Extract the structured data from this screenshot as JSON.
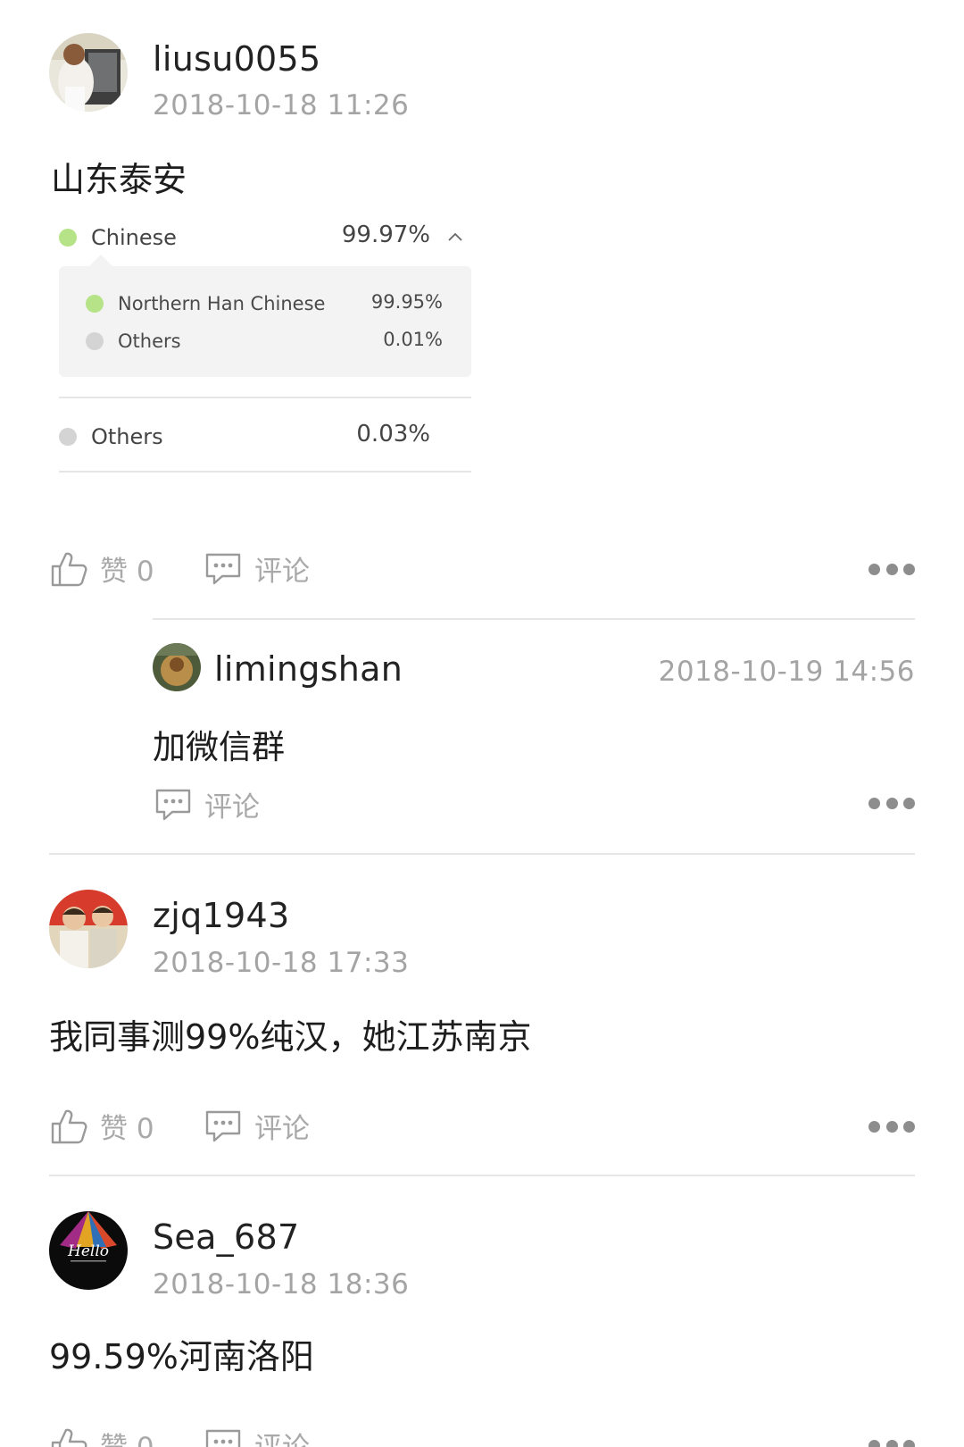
{
  "posts": [
    {
      "username": "liusu0055",
      "date": "2018-10-18 11:26",
      "content": "山东泰安",
      "ancestry": {
        "top": {
          "label": "Chinese",
          "percent": "99.97%",
          "color": "#b6e388"
        },
        "sub": [
          {
            "label": "Northern Han Chinese",
            "percent": "99.95%",
            "color": "#b6e388"
          },
          {
            "label": "Others",
            "percent": "0.01%",
            "color": "#d4d4d4"
          }
        ],
        "other": {
          "label": "Others",
          "percent": "0.03%",
          "color": "#d4d4d4"
        }
      },
      "like_label": "赞 0",
      "comment_label": "评论",
      "reply": {
        "username": "limingshan",
        "date": "2018-10-19 14:56",
        "content": "加微信群",
        "comment_label": "评论"
      }
    },
    {
      "username": "zjq1943",
      "date": "2018-10-18 17:33",
      "content": "我同事测99%纯汉，她江苏南京",
      "like_label": "赞 0",
      "comment_label": "评论"
    },
    {
      "username": "Sea_687",
      "date": "2018-10-18 18:36",
      "content": "99.59%河南洛阳",
      "avatar_text": "Hello",
      "like_label": "赞 0",
      "comment_label": "评论"
    }
  ],
  "icons": {
    "like": "thumbs-up-icon",
    "comment": "comment-bubble-icon",
    "more": "more-dots-icon",
    "collapse": "chevron-up-icon"
  },
  "colors": {
    "text_gray": "#a4a4a4",
    "divider": "#e6e6e6",
    "ancestry_green": "#b6e388",
    "ancestry_gray": "#d4d4d4"
  }
}
